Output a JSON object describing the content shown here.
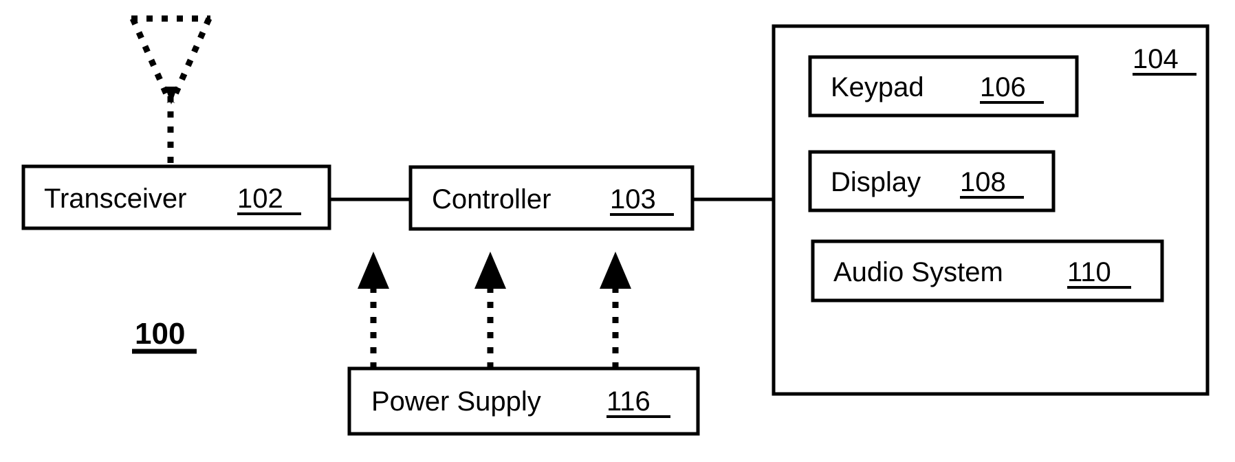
{
  "figure": {
    "figure_number": "100",
    "background_color": "#ffffff",
    "line_color": "#000000"
  },
  "blocks": {
    "transceiver": {
      "label": "Transceiver",
      "ref": "102"
    },
    "controller": {
      "label": "Controller",
      "ref": "103"
    },
    "user_interface": {
      "ref": "104"
    },
    "keypad": {
      "label": "Keypad",
      "ref": "106"
    },
    "display": {
      "label": "Display",
      "ref": "108"
    },
    "audio_system": {
      "label": "Audio System",
      "ref": "110"
    },
    "power_supply": {
      "label": "Power Supply",
      "ref": "116"
    }
  },
  "icons": {
    "antenna": "antenna-icon",
    "power_arrow": "power-arrow-icon"
  },
  "connections": [
    {
      "from": "transceiver",
      "to": "controller",
      "style": "solid"
    },
    {
      "from": "controller",
      "to": "user_interface",
      "style": "solid"
    },
    {
      "from": "antenna",
      "to": "transceiver",
      "style": "dotted"
    },
    {
      "from": "power_supply",
      "to": "transceiver",
      "style": "dotted-arrow"
    },
    {
      "from": "power_supply",
      "to": "controller",
      "style": "dotted-arrow"
    },
    {
      "from": "power_supply",
      "to": "user_interface",
      "style": "dotted-arrow"
    }
  ]
}
